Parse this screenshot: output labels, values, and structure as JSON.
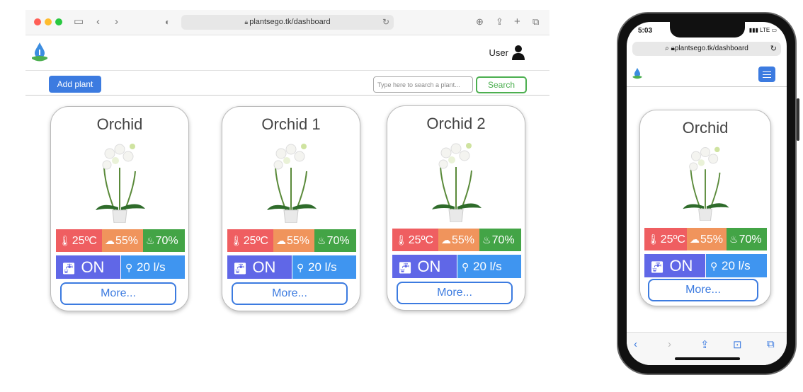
{
  "browser": {
    "url": "plantsego.tk/dashboard",
    "icons": [
      "sidebar-icon",
      "back-icon",
      "forward-icon",
      "shield-icon",
      "reload-icon",
      "download-icon",
      "share-icon",
      "new-tab-icon",
      "tabs-icon"
    ]
  },
  "header": {
    "user_label": "User"
  },
  "toolbar": {
    "add_label": "Add plant",
    "search_placeholder": "Type here to search a plant...",
    "search_label": "Search"
  },
  "colors": {
    "primary": "#3c7be0",
    "temperature": "#ef5e61",
    "humidity": "#f0945c",
    "soil": "#43a446",
    "pump": "#6067e7",
    "flow": "#3f95f0",
    "search": "#4caf50"
  },
  "cards": [
    {
      "name": "Orchid",
      "temperature": "25ºC",
      "humidity": "55%",
      "soil": "70%",
      "pump": "ON",
      "flow": "20 l/s",
      "more_label": "More..."
    },
    {
      "name": "Orchid 1",
      "temperature": "25ºC",
      "humidity": "55%",
      "soil": "70%",
      "pump": "ON",
      "flow": "20 l/s",
      "more_label": "More..."
    },
    {
      "name": "Orchid 2",
      "temperature": "25ºC",
      "humidity": "55%",
      "soil": "70%",
      "pump": "ON",
      "flow": "20 l/s",
      "more_label": "More..."
    }
  ],
  "phone": {
    "time": "5:03",
    "network": "LTE",
    "url": "plantsego.tk/dashboard",
    "card": {
      "name": "Orchid",
      "temperature": "25ºC",
      "humidity": "55%",
      "soil": "70%",
      "pump": "ON",
      "flow": "20 l/s",
      "more_label": "More..."
    },
    "toolbar_icons": [
      "back-icon",
      "forward-icon",
      "share-icon",
      "bookmarks-icon",
      "tabs-icon"
    ]
  }
}
